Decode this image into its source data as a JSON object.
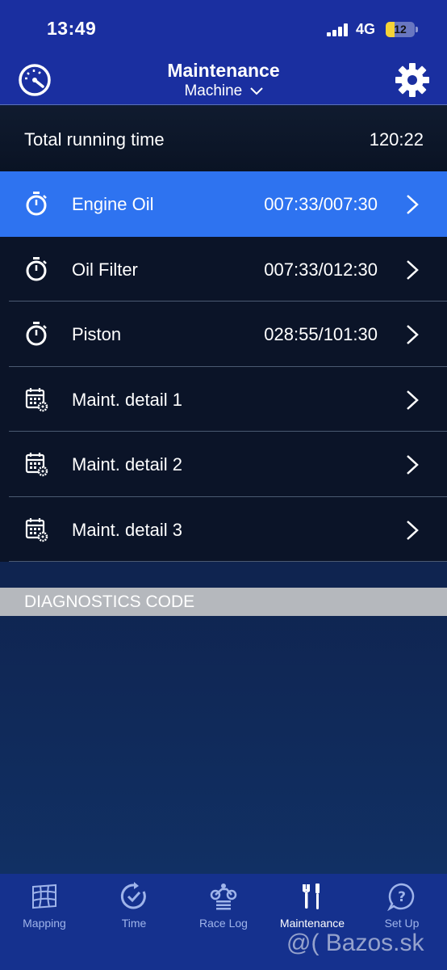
{
  "status_bar": {
    "time": "13:49",
    "network": "4G",
    "battery": "12"
  },
  "header": {
    "title": "Maintenance",
    "subtitle": "Machine",
    "left_icon": "speedometer-icon",
    "right_icon": "gear-icon"
  },
  "total": {
    "label": "Total running time",
    "value": "120:22"
  },
  "items": [
    {
      "label": "Engine Oil",
      "value": "007:33/007:30",
      "icon": "stopwatch-icon",
      "active": true
    },
    {
      "label": "Oil Filter",
      "value": "007:33/012:30",
      "icon": "stopwatch-icon",
      "active": false
    },
    {
      "label": "Piston",
      "value": "028:55/101:30",
      "icon": "stopwatch-icon",
      "active": false
    },
    {
      "label": "Maint. detail 1",
      "value": "",
      "icon": "calendar-gear-icon",
      "active": false
    },
    {
      "label": "Maint. detail 2",
      "value": "",
      "icon": "calendar-gear-icon",
      "active": false
    },
    {
      "label": "Maint. detail 3",
      "value": "",
      "icon": "calendar-gear-icon",
      "active": false
    }
  ],
  "diagnostics": {
    "label": "DIAGNOSTICS CODE"
  },
  "tabs": [
    {
      "label": "Mapping",
      "icon": "map-grid-icon",
      "active": false
    },
    {
      "label": "Time",
      "icon": "clock-check-icon",
      "active": false
    },
    {
      "label": "Race Log",
      "icon": "motorbike-icon",
      "active": false
    },
    {
      "label": "Maintenance",
      "icon": "tools-icon",
      "active": true
    },
    {
      "label": "Set Up",
      "icon": "help-bubble-icon",
      "active": false
    }
  ],
  "watermark": "@( Bazos.sk",
  "colors": {
    "header_bg": "#1a2fa0",
    "active_row": "#2e73f0",
    "list_bg": "#0b1428",
    "diag_bar": "#b5b8bd",
    "tabbar_bg": "#15318e"
  }
}
